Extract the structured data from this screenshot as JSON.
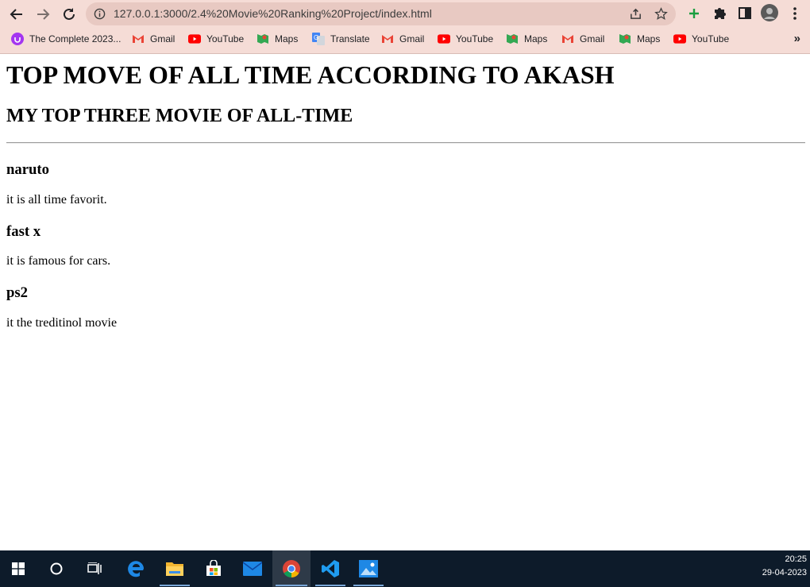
{
  "browser": {
    "url": "127.0.0.1:3000/2.4%20Movie%20Ranking%20Project/index.html"
  },
  "bookmarks": [
    {
      "label": "The Complete 2023...",
      "icon": "udemy-icon"
    },
    {
      "label": "Gmail",
      "icon": "gmail-icon"
    },
    {
      "label": "YouTube",
      "icon": "youtube-icon"
    },
    {
      "label": "Maps",
      "icon": "maps-icon"
    },
    {
      "label": "Translate",
      "icon": "translate-icon"
    },
    {
      "label": "Gmail",
      "icon": "gmail-icon"
    },
    {
      "label": "YouTube",
      "icon": "youtube-icon"
    },
    {
      "label": "Maps",
      "icon": "maps-icon"
    },
    {
      "label": "Gmail",
      "icon": "gmail-icon"
    },
    {
      "label": "Maps",
      "icon": "maps-icon"
    },
    {
      "label": "YouTube",
      "icon": "youtube-icon"
    }
  ],
  "bookmarks_more": "»",
  "page": {
    "heading": "TOP MOVE OF ALL TIME ACCORDING TO AKASH",
    "subheading": "MY TOP THREE MOVIE OF ALL-TIME",
    "movies": [
      {
        "title": "naruto",
        "description": "it is all time favorit."
      },
      {
        "title": "fast x",
        "description": "it is famous for cars."
      },
      {
        "title": "ps2",
        "description": "it the treditinol movie"
      }
    ]
  },
  "taskbar": {
    "apps": [
      "windows-start-icon",
      "search-icon",
      "task-view-icon",
      "edge-icon",
      "file-explorer-icon",
      "store-icon",
      "mail-icon",
      "chrome-icon",
      "vscode-icon",
      "photos-icon"
    ],
    "time": "20:25",
    "date": "29-04-2023"
  },
  "colors": {
    "toolbar": "#f5dcd6",
    "omnibox": "#e8c9c2",
    "taskbar": "#0d1b2a"
  }
}
